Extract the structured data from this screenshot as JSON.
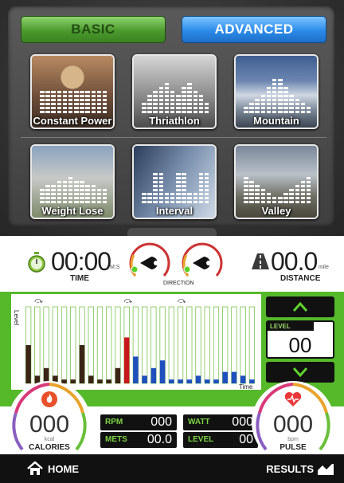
{
  "tabs": {
    "basic": "BASIC",
    "advanced": "ADVANCED",
    "active": "advanced"
  },
  "programs": [
    {
      "label": "Constant Power",
      "icon": "weightlifter-photo"
    },
    {
      "label": "Thriathlon",
      "icon": "triathlon-photo"
    },
    {
      "label": "Mountain",
      "icon": "mountain-photo"
    },
    {
      "label": "Weight Lose",
      "icon": "hula-hoop-photo"
    },
    {
      "label": "Interval",
      "icon": "interval-photo"
    },
    {
      "label": "Valley",
      "icon": "valley-photo"
    }
  ],
  "time": {
    "value": "00:00",
    "unit": "M:S",
    "label": "TIME"
  },
  "direction": {
    "label": "DIRECTION"
  },
  "distance": {
    "value": "00.0",
    "unit": "mile",
    "label": "DISTANCE"
  },
  "chart_data": {
    "type": "bar",
    "ylabel": "Level",
    "xlabel": "Time",
    "segment_markers": [
      "⤼",
      "⤼",
      "⤼"
    ],
    "current_index": 11,
    "colors": {
      "past": "#3b2416",
      "current": "#c8161d",
      "future": "#1f4fbf",
      "empty": "#ffffff"
    },
    "values": [
      10,
      2,
      4,
      2,
      1,
      1,
      10,
      2,
      1,
      1,
      4,
      12,
      7,
      2,
      4,
      6,
      1,
      1,
      1,
      2,
      1,
      1,
      3,
      3,
      2,
      1
    ]
  },
  "level": {
    "title": "LEVEL",
    "value": "00"
  },
  "calories": {
    "value": "000",
    "unit": "kcal",
    "label": "CALORIES"
  },
  "pulse": {
    "value": "000",
    "unit": "bpm",
    "label": "PULSE"
  },
  "stats": {
    "rpm": {
      "label": "RPM",
      "value": "000"
    },
    "watt": {
      "label": "WATT",
      "value": "000"
    },
    "mets": {
      "label": "METS",
      "value": "00.0"
    },
    "level": {
      "label": "LEVEL",
      "value": "00"
    }
  },
  "footer": {
    "home": "HOME",
    "results": "RESULTS"
  }
}
